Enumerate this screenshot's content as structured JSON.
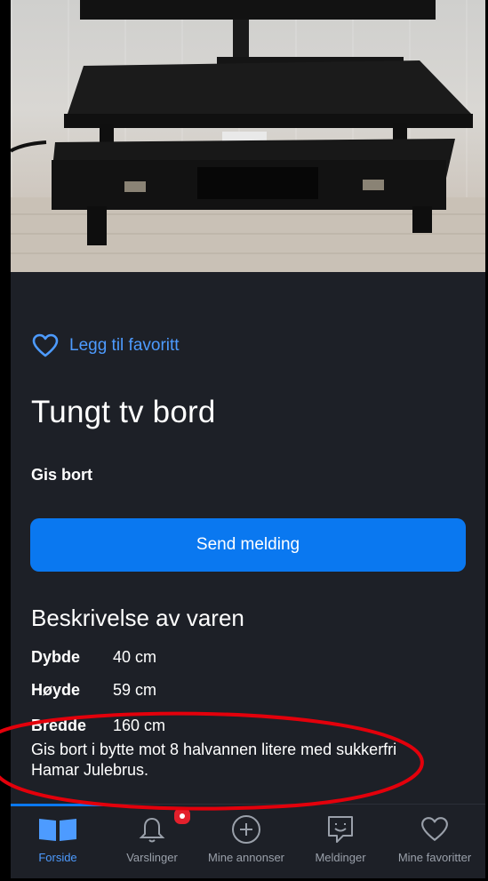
{
  "listing": {
    "favorite_label": "Legg til favoritt",
    "title": "Tungt tv bord",
    "price_label": "Gis bort",
    "send_button": "Send melding"
  },
  "description": {
    "heading": "Beskrivelse av varen",
    "specs": [
      {
        "key": "Dybde",
        "value": "40 cm"
      },
      {
        "key": "Høyde",
        "value": "59 cm"
      },
      {
        "key": "Bredde",
        "value": "160 cm"
      }
    ],
    "text": "Gis bort i bytte mot 8 halvannen litere med sukkerfri Hamar Julebrus."
  },
  "tabs": [
    {
      "label": "Forside",
      "icon": "home-book-icon",
      "active": true
    },
    {
      "label": "Varslinger",
      "icon": "bell-icon",
      "badge": true
    },
    {
      "label": "Mine annonser",
      "icon": "plus-circle-icon"
    },
    {
      "label": "Meldinger",
      "icon": "chat-smile-icon"
    },
    {
      "label": "Mine favoritter",
      "icon": "heart-icon"
    }
  ],
  "colors": {
    "accent": "#0a78f0",
    "link": "#4d9bff",
    "background": "#1d2027",
    "annotation": "#e3000b",
    "badge": "#e3202c"
  }
}
